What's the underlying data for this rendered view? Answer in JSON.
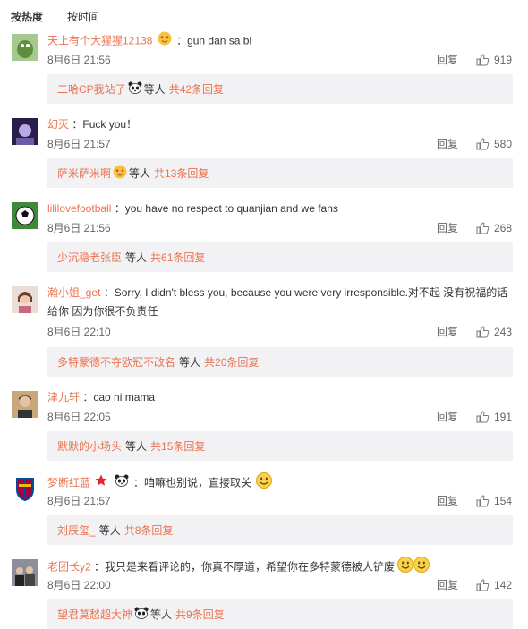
{
  "sort": {
    "hot": "按热度",
    "time": "按时间"
  },
  "comments": [
    {
      "user": "天上有个大猩猩12138",
      "text": "：gun dan sa bi",
      "date": "8月6日 21:56",
      "reply": "回复",
      "likes": "919",
      "sub": {
        "user": "二哈CP我站了",
        "deng": "等人",
        "count": "共42条回复"
      }
    },
    {
      "user": "幻灭",
      "text": "：Fuck you！",
      "date": "8月6日 21:57",
      "reply": "回复",
      "likes": "580",
      "sub": {
        "user": "萨米萨米啊",
        "deng": "等人",
        "count": "共13条回复"
      }
    },
    {
      "user": "lililovefootball",
      "text": "：you have no respect to quanjian and we fans",
      "date": "8月6日 21:56",
      "reply": "回复",
      "likes": "268",
      "sub": {
        "user": "少沉稳老张臣",
        "deng": "等人",
        "count": "共61条回复"
      }
    },
    {
      "user": "瀚小姐_get",
      "text": "：Sorry, I didn't bless you, because you were very irresponsible.对不起 没有祝福的话",
      "text2": "给你 因为你很不负责任",
      "date": "8月6日 22:10",
      "reply": "回复",
      "likes": "243",
      "sub": {
        "user": "多特蒙德不夺欧冠不改名",
        "deng": "等人",
        "count": "共20条回复"
      }
    },
    {
      "user": "津九轩",
      "text": "：cao ni mama",
      "date": "8月6日 22:05",
      "reply": "回复",
      "likes": "191",
      "sub": {
        "user": "默默的小场头",
        "deng": "等人",
        "count": "共15条回复"
      }
    },
    {
      "user": "梦断红蓝",
      "text": "：咱嘛也别说，直接取关",
      "date": "8月6日 21:57",
      "reply": "回复",
      "likes": "154",
      "sub": {
        "user": "刘辰玺_",
        "deng": "等人",
        "count": "共8条回复"
      }
    },
    {
      "user": "老团长y2",
      "text": "：我只是来看评论的，你真不厚道，希望你在多特蒙德被人铲废",
      "date": "8月6日 22:00",
      "reply": "回复",
      "likes": "142",
      "sub": {
        "user": "望君莫愁超大神",
        "deng": "等人",
        "count": "共9条回复"
      }
    }
  ]
}
